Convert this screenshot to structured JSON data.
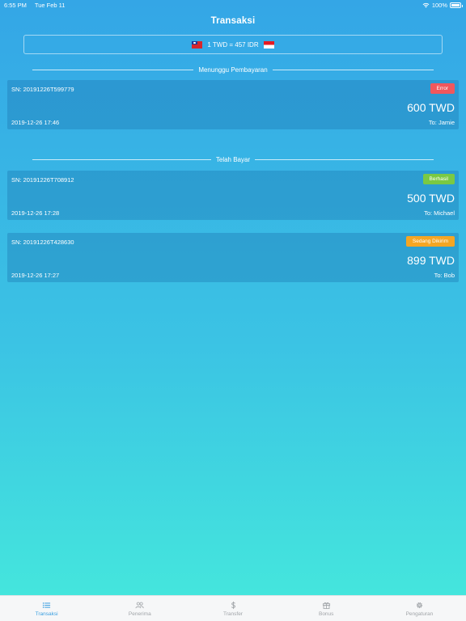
{
  "status_bar": {
    "time": "6:55 PM",
    "date": "Tue Feb 11",
    "battery": "100%"
  },
  "header": {
    "title": "Transaksi"
  },
  "rate": {
    "text": "1 TWD = 457 IDR",
    "from_flag": "taiwan-flag",
    "to_flag": "indonesia-flag"
  },
  "sections": {
    "pending": {
      "label": "Menunggu Pembayaran",
      "items": [
        {
          "sn": "SN: 20191226T599779",
          "status": "Error",
          "status_color": "#f0575d",
          "amount": "600 TWD",
          "date": "2019-12-26 17:46",
          "to": "To: Jamie"
        }
      ]
    },
    "paid": {
      "label": "Telah Bayar",
      "items": [
        {
          "sn": "SN: 20191226T708912",
          "status": "Berhasil",
          "status_color": "#7ac943",
          "amount": "500 TWD",
          "date": "2019-12-26 17:28",
          "to": "To: Michael"
        },
        {
          "sn": "SN: 20191226T428630",
          "status": "Sedang Dikirim",
          "status_color": "#f5a623",
          "amount": "899 TWD",
          "date": "2019-12-26 17:27",
          "to": "To: Bob"
        }
      ]
    }
  },
  "tab_bar": {
    "active_color": "#3b9fe0",
    "tabs": [
      {
        "label": "Transaksi",
        "icon": "list-icon",
        "active": true
      },
      {
        "label": "Penerima",
        "icon": "people-icon",
        "active": false
      },
      {
        "label": "Transfer",
        "icon": "dollar-icon",
        "active": false
      },
      {
        "label": "Bonus",
        "icon": "gift-icon",
        "active": false
      },
      {
        "label": "Pengaturan",
        "icon": "gear-icon",
        "active": false
      }
    ]
  }
}
